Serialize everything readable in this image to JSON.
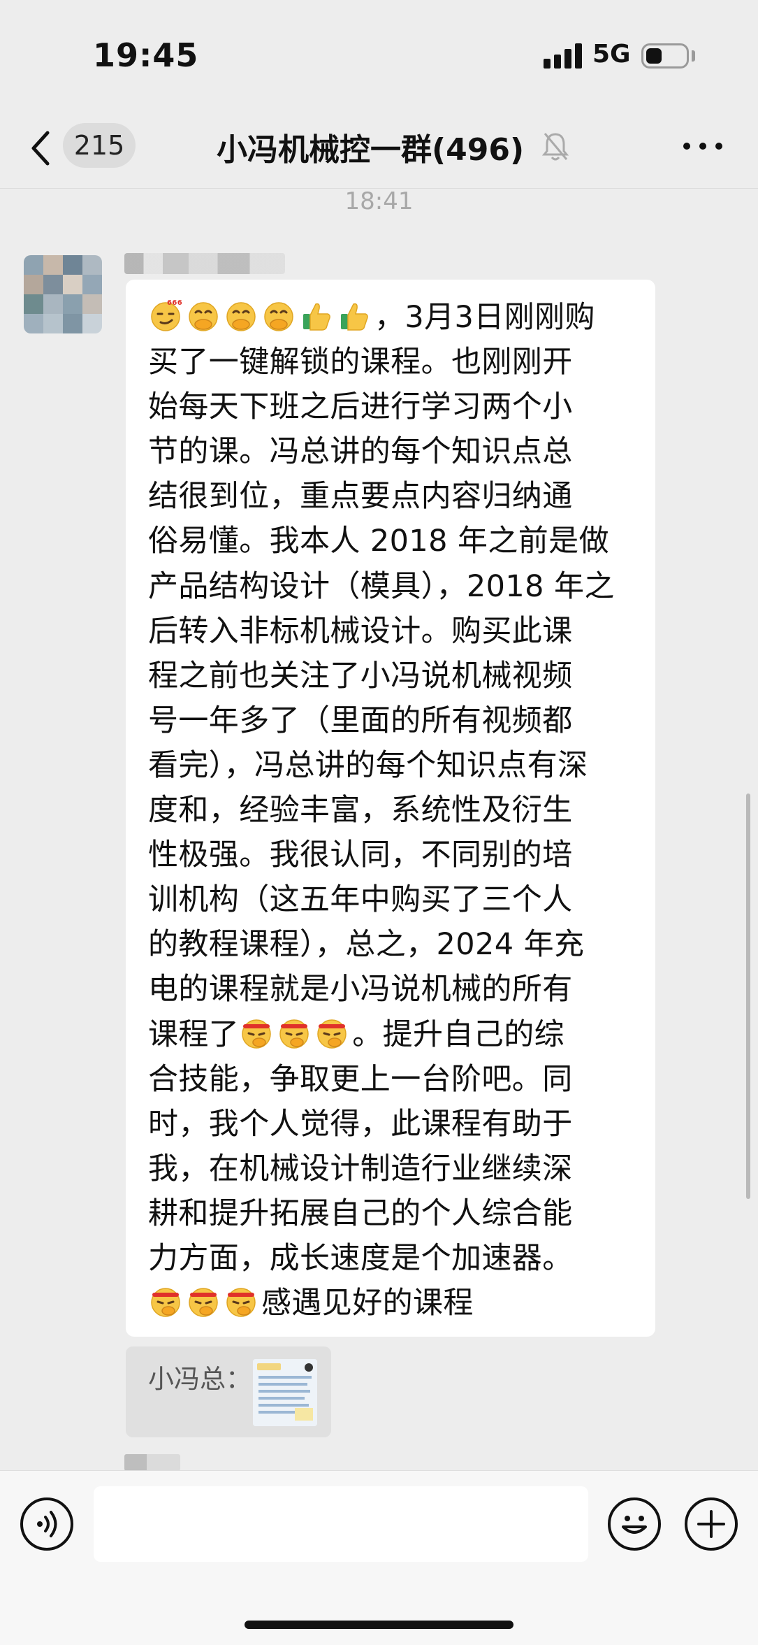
{
  "status_bar": {
    "time": "19:45",
    "network": "5G",
    "icons": [
      "cellular-signal-icon",
      "battery-icon"
    ]
  },
  "nav": {
    "unread_count": "215",
    "title": "小冯机械控一群(496)",
    "icons": [
      "chevron-left-icon",
      "bell-muted-icon",
      "more-dots-icon"
    ]
  },
  "chat": {
    "timestamp": "18:41",
    "message": {
      "lines": [
        {
          "emojis_before": [
            "smirk-666-emoji",
            "hand-over-mouth-emoji",
            "hand-over-mouth-emoji",
            "hand-over-mouth-emoji",
            "thumbs-up-emoji",
            "thumbs-up-emoji"
          ],
          "text": "，3月3日刚刚购"
        },
        {
          "text": "买了一键解锁的课程。也刚刚开"
        },
        {
          "text": "始每天下班之后进行学习两个小"
        },
        {
          "text": "节的课。冯总讲的每个知识点总"
        },
        {
          "text": "结很到位，重点要点内容归纳通"
        },
        {
          "text": "俗易懂。我本人 2018 年之前是做"
        },
        {
          "text": "产品结构设计（模具），2018 年之"
        },
        {
          "text": "后转入非标机械设计。购买此课"
        },
        {
          "text": "程之前也关注了小冯说机械视频"
        },
        {
          "text": "号一年多了（里面的所有视频都"
        },
        {
          "text": "看完），冯总讲的每个知识点有深"
        },
        {
          "text": "度和，经验丰富，系统性及衍生"
        },
        {
          "text": "性极强。我很认同，不同别的培"
        },
        {
          "text": "训机构（这五年中购买了三个人"
        },
        {
          "text": "的教程课程），总之，2024 年充"
        },
        {
          "text": "电的课程就是小冯说机械的所有"
        },
        {
          "text_before": "课程了",
          "emojis_mid": [
            "headband-emoji",
            "headband-emoji",
            "headband-emoji"
          ],
          "text": "。提升自己的综"
        },
        {
          "text": "合技能，争取更上一台阶吧。同"
        },
        {
          "text": "时，我个人觉得，此课程有助于"
        },
        {
          "text": "我，在机械设计制造行业继续深"
        },
        {
          "text": "耕和提升拓展自己的个人综合能"
        },
        {
          "text": "力方面，成长速度是个加速器。"
        },
        {
          "emojis_before": [
            "headband-emoji",
            "headband-emoji",
            "headband-emoji"
          ],
          "text": "感遇见好的课程"
        }
      ]
    },
    "quote": {
      "author": "小冯总："
    }
  },
  "input_bar": {
    "placeholder": "",
    "icons": [
      "voice-icon",
      "emoji-face-icon",
      "plus-icon"
    ]
  },
  "colors": {
    "background": "#ededed",
    "bubble": "#ffffff",
    "timestamp": "#a8a8a8"
  }
}
